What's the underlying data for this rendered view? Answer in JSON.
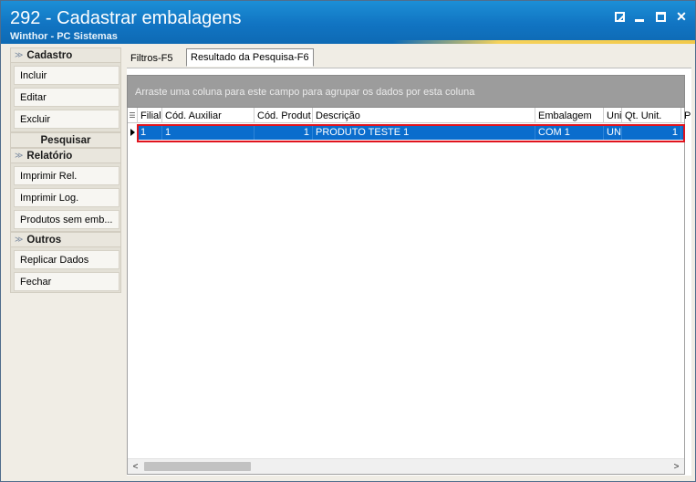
{
  "window": {
    "title": "292 - Cadastrar embalagens",
    "subtitle": "Winthor - PC Sistemas",
    "controls": {
      "close": "✕"
    }
  },
  "sidebar": {
    "cadastro": {
      "title": "Cadastro",
      "items": [
        "Incluir",
        "Editar",
        "Excluir"
      ]
    },
    "pesquisar": {
      "title": "Pesquisar"
    },
    "relatorio": {
      "title": "Relatório",
      "items": [
        "Imprimir Rel.",
        "Imprimir Log.",
        "Produtos sem emb..."
      ]
    },
    "outros": {
      "title": "Outros",
      "items": [
        "Replicar Dados",
        "Fechar"
      ]
    }
  },
  "tabs": [
    "Filtros-F5",
    "Resultado da Pesquisa-F6"
  ],
  "grid": {
    "group_hint": "Arraste uma coluna para este campo para agrupar os dados por esta coluna",
    "columns": [
      "Filial",
      "Cód. Auxiliar",
      "Cód. Produt",
      "Descrição",
      "Embalagem",
      "Uni",
      "Qt. Unit.",
      "P"
    ],
    "rows": [
      [
        "1",
        "1",
        "1",
        "PRODUTO TESTE 1",
        "COM 1",
        "UN",
        "1",
        ""
      ]
    ],
    "selected_row": 0
  },
  "colors": {
    "titlebar": "#1174c2",
    "selection": "#0a6dcd",
    "highlight_outline": "#e0141e"
  }
}
